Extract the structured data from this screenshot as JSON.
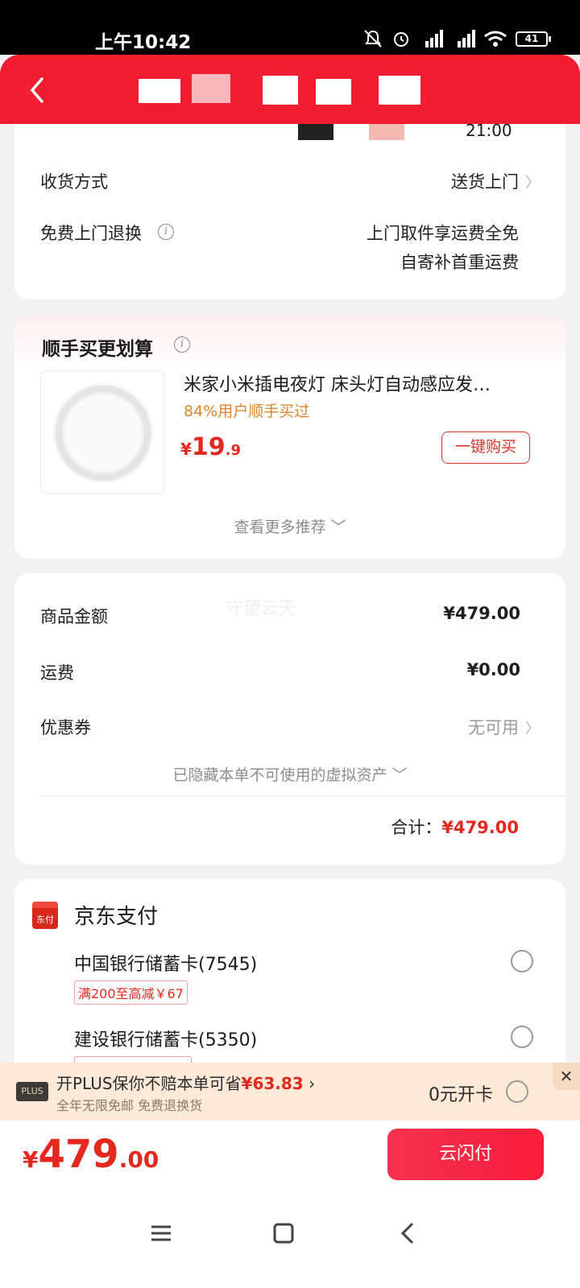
{
  "status_bar": {
    "time": "上午10:42",
    "battery": "41"
  },
  "header": {
    "back_label": "返回"
  },
  "delivery_card": {
    "time_partial": "21:00",
    "delivery_method_label": "收货方式",
    "delivery_method_value": "送货上门",
    "free_return_label": "免费上门退换",
    "free_return_line1": "上门取件享运费全免",
    "free_return_line2": "自寄补首重运费"
  },
  "recommend": {
    "title": "顺手买更划算",
    "product_name": "米家小米插电夜灯 床头灯自动感应发…",
    "product_sub": "84%用户顺手买过",
    "price_currency": "¥",
    "price_int": "19",
    "price_dec": ".9",
    "buy_label": "一键购买",
    "more_label": "查看更多推荐"
  },
  "summary": {
    "watermark": "守望云天",
    "goods_label": "商品金额",
    "goods_value": "¥479.00",
    "shipping_label": "运费",
    "shipping_value": "¥0.00",
    "coupon_label": "优惠券",
    "coupon_value": "无可用",
    "hidden_assets": "已隐藏本单不可使用的虚拟资产",
    "total_label": "合计：",
    "total_value": "¥479.00"
  },
  "payment": {
    "title": "京东支付",
    "icon_text": "东付",
    "methods": [
      {
        "name": "中国银行储蓄卡(7545)",
        "tag": "满200至高减￥67"
      },
      {
        "name": "建设银行储蓄卡(5350)",
        "tag": ""
      }
    ]
  },
  "plus": {
    "badge": "PLUS",
    "main_text": "开PLUS保你不赔本单可省",
    "save_amount": "¥63.83",
    "sub_text": "全年无限免邮 免费退换货",
    "open_text": "0元开卡",
    "close": "✕"
  },
  "bottom": {
    "currency": "¥",
    "price_int": "479",
    "price_dec": ".00",
    "pay_label": "云闪付"
  },
  "colors": {
    "brand_red": "#f11d30",
    "price_red": "#e5281f",
    "accent_orange": "#d9862b"
  }
}
